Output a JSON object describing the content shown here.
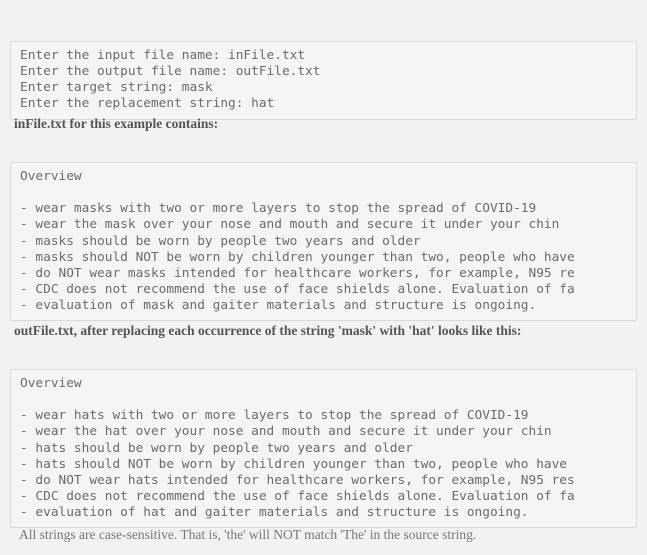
{
  "page": {
    "background_color": "#f2f2f2",
    "code_block_background": "#f5f5f5",
    "code_block_border_color": "#d9d9d9",
    "code_text_color": "#6b6b6b",
    "caption_text_color": "#555555",
    "footnote_text_color": "#777777"
  },
  "console_block": {
    "lines": [
      "Enter the input file name: inFile.txt",
      "Enter the output file name: outFile.txt",
      "Enter target string: mask",
      "Enter the replacement string: hat"
    ]
  },
  "infile_caption": "inFile.txt for this example contains:",
  "infile_block": {
    "lines": [
      "Overview",
      "",
      "- wear masks with two or more layers to stop the spread of COVID-19",
      "- wear the mask over your nose and mouth and secure it under your chin",
      "- masks should be worn by people two years and older",
      "- masks should NOT be worn by children younger than two, people who have",
      "- do NOT wear masks intended for healthcare workers, for example, N95 re",
      "- CDC does not recommend the use of face shields alone. Evaluation of fa",
      "- evaluation of mask and gaiter materials and structure is ongoing."
    ]
  },
  "outfile_caption": "outFile.txt, after replacing each occurrence of the string 'mask' with 'hat' looks like this:",
  "outfile_block": {
    "lines": [
      "Overview",
      "",
      "- wear hats with two or more layers to stop the spread of COVID-19",
      "- wear the hat over your nose and mouth and secure it under your chin",
      "- hats should be worn by people two years and older",
      "- hats should NOT be worn by children younger than two, people who have",
      "- do NOT wear hats intended for healthcare workers, for example, N95 res",
      "- CDC does not recommend the use of face shields alone. Evaluation of fa",
      "- evaluation of hat and gaiter materials and structure is ongoing."
    ]
  },
  "footnote": "All strings are case-sensitive. That is, 'the' will NOT match 'The' in the source string."
}
